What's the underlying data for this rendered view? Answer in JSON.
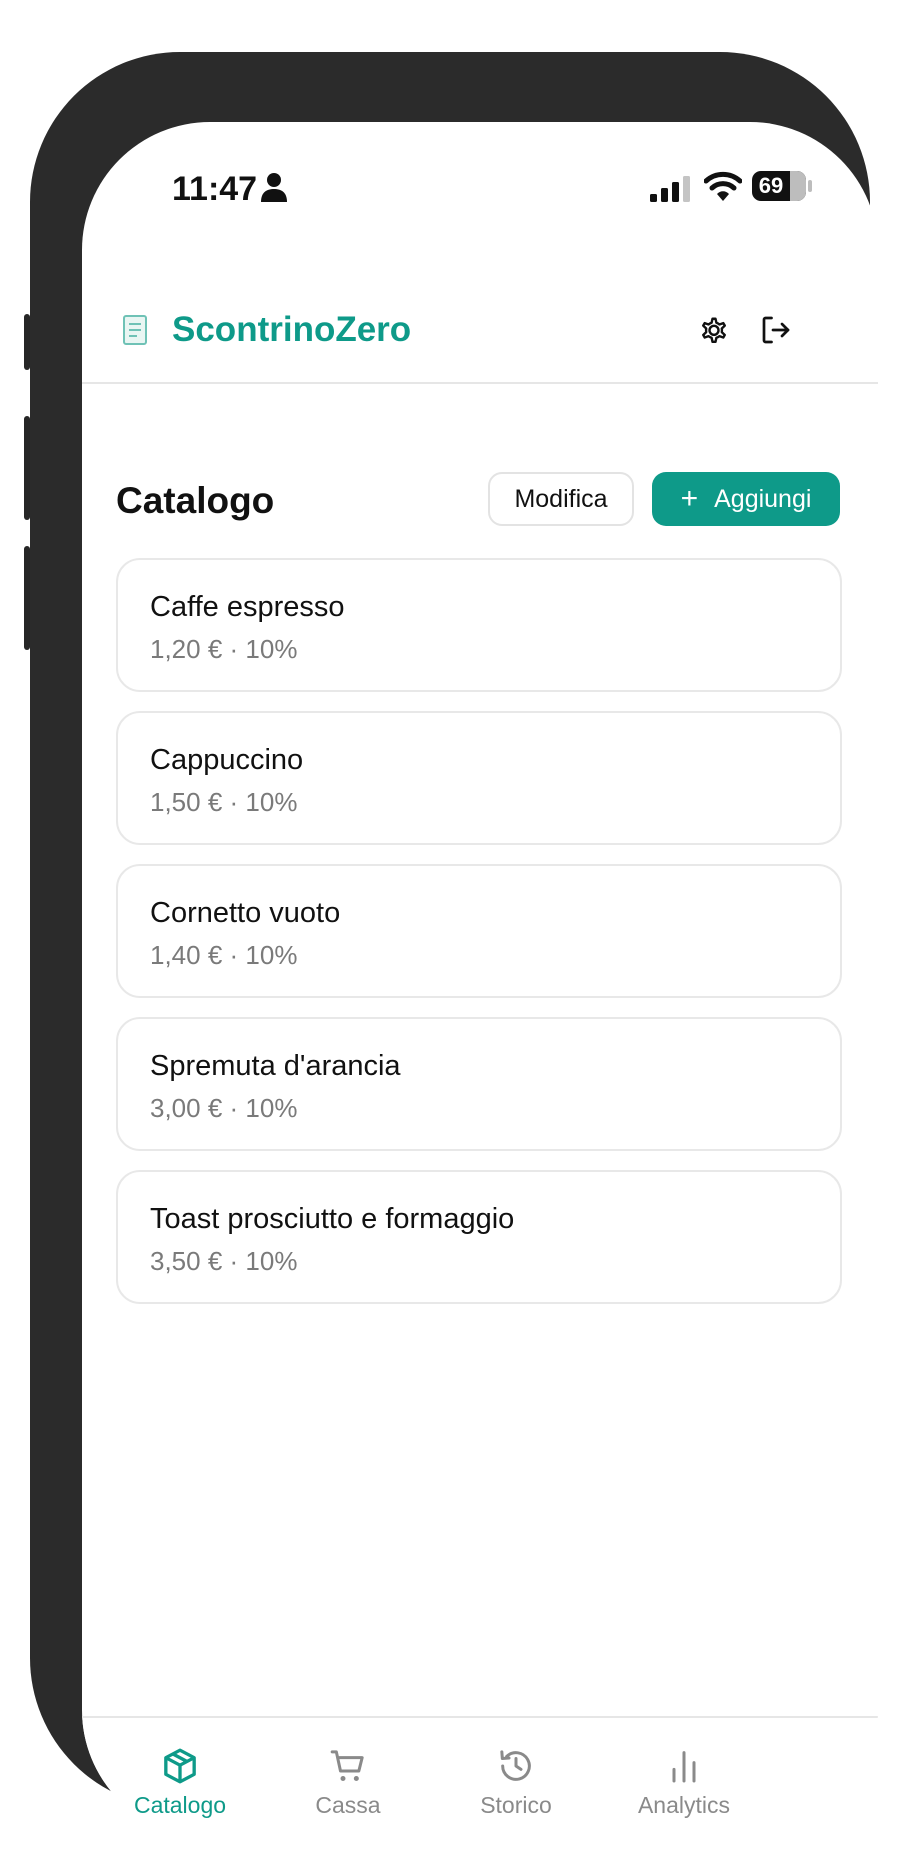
{
  "status_bar": {
    "time": "11:47",
    "battery": "69"
  },
  "header": {
    "app_title": "ScontrinoZero",
    "icons": {
      "logo": "receipt-icon",
      "settings": "gear-icon",
      "logout": "logout-icon"
    }
  },
  "page": {
    "title": "Catalogo",
    "edit_label": "Modifica",
    "add_label": "Aggiungi"
  },
  "catalog": {
    "items": [
      {
        "name": "Caffe espresso",
        "meta": "1,20 € · 10%"
      },
      {
        "name": "Cappuccino",
        "meta": "1,50 € · 10%"
      },
      {
        "name": "Cornetto vuoto",
        "meta": "1,40 € · 10%"
      },
      {
        "name": "Spremuta d'arancia",
        "meta": "3,00 € · 10%"
      },
      {
        "name": "Toast prosciutto e formaggio",
        "meta": "3,50 € · 10%"
      }
    ]
  },
  "nav": {
    "items": [
      {
        "label": "Catalogo",
        "icon": "box-icon",
        "active": true
      },
      {
        "label": "Cassa",
        "icon": "cart-icon",
        "active": false
      },
      {
        "label": "Storico",
        "icon": "history-icon",
        "active": false
      },
      {
        "label": "Analytics",
        "icon": "bar-chart-icon",
        "active": false
      }
    ]
  },
  "colors": {
    "accent": "#0e9a89",
    "text": "#111111",
    "muted": "#7a7a7a",
    "border": "#e8e8e8"
  }
}
